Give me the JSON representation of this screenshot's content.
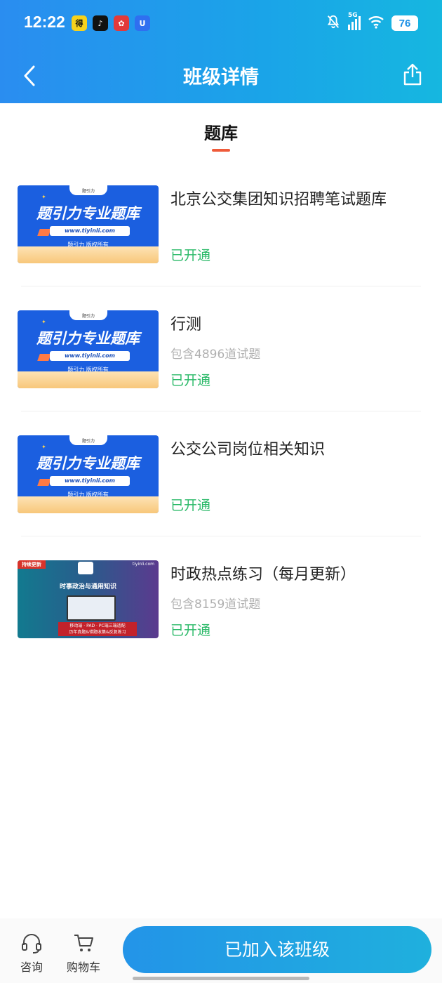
{
  "status_bar": {
    "time": "12:22",
    "battery": "76",
    "network": "5G",
    "app_icons": [
      {
        "name": "app-icon-yellow",
        "glyph": "得",
        "color": "#f7d21c"
      },
      {
        "name": "app-icon-tiktok",
        "glyph": "♪",
        "color": "#111111"
      },
      {
        "name": "app-icon-red",
        "glyph": "✿",
        "color": "#e23a3a"
      },
      {
        "name": "app-icon-blue",
        "glyph": "U",
        "color": "#2f6ff0"
      }
    ]
  },
  "header": {
    "title": "班级详情"
  },
  "section": {
    "title": "题库"
  },
  "thumbnail_text": {
    "blue_headline": "题引力专业题库",
    "blue_url": "www.tiyinli.com",
    "blue_copyright": "题引力 版权所有",
    "blue_logo": "题引力",
    "dark_tag": "持续更新",
    "dark_site": "tiyinli.com",
    "dark_headline": "时事政治与通用知识",
    "dark_line1": "移动端 · PAD · PC端三端适配",
    "dark_line2": "历年真题&错题收集&反复练习"
  },
  "items": [
    {
      "title": "北京公交集团知识招聘笔试题库",
      "subtitle": "",
      "status": "已开通",
      "thumb": "blue"
    },
    {
      "title": "行测",
      "subtitle": "包含4896道试题",
      "status": "已开通",
      "thumb": "blue"
    },
    {
      "title": "公交公司岗位相关知识",
      "subtitle": "",
      "status": "已开通",
      "thumb": "blue"
    },
    {
      "title": "时政热点练习（每月更新）",
      "subtitle": "包含8159道试题",
      "status": "已开通",
      "thumb": "dark"
    }
  ],
  "bottom_bar": {
    "consult_label": "咨询",
    "cart_label": "购物车",
    "cta_label": "已加入该班级"
  },
  "colors": {
    "header_gradient_start": "#2a8df0",
    "header_gradient_end": "#16b7e0",
    "accent_underline": "#ef5b3a",
    "status_green": "#2dba6a",
    "subtitle_gray": "#b0b0b0"
  }
}
